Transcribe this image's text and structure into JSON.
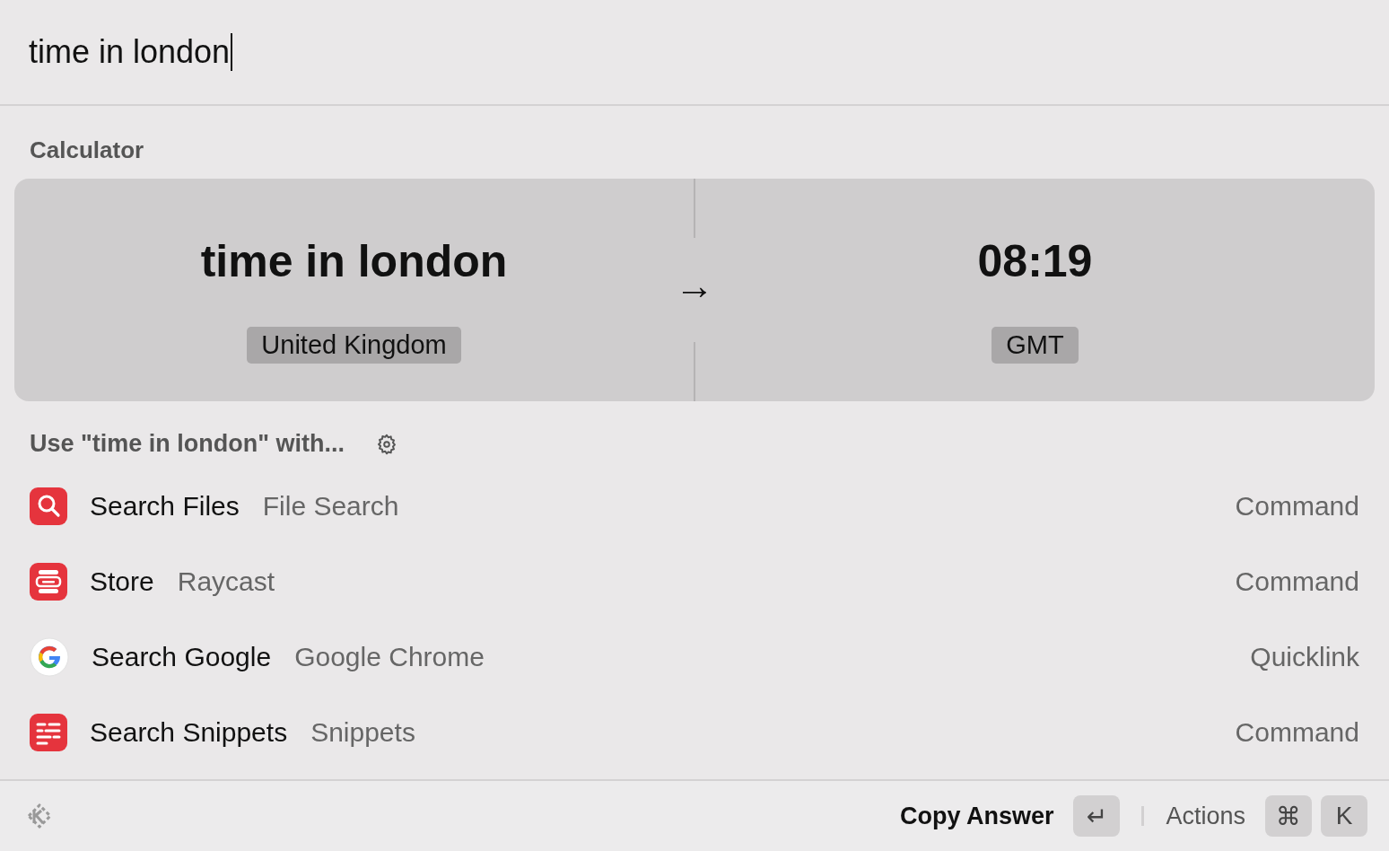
{
  "search": {
    "value": "time in london"
  },
  "calculator": {
    "section_title": "Calculator",
    "query": "time in london",
    "query_tag": "United Kingdom",
    "arrow": "→",
    "result": "08:19",
    "result_tag": "GMT"
  },
  "suggestions": {
    "title": "Use \"time in london\" with...",
    "items": [
      {
        "kind": "search",
        "title": "Search Files",
        "subtitle": "File Search",
        "type": "Command"
      },
      {
        "kind": "store",
        "title": "Store",
        "subtitle": "Raycast",
        "type": "Command"
      },
      {
        "kind": "google",
        "title": "Search Google",
        "subtitle": "Google Chrome",
        "type": "Quicklink"
      },
      {
        "kind": "snippets",
        "title": "Search Snippets",
        "subtitle": "Snippets",
        "type": "Command"
      }
    ]
  },
  "footer": {
    "primary_action": "Copy Answer",
    "primary_key": "↵",
    "actions_label": "Actions",
    "action_keys": [
      "⌘",
      "K"
    ]
  }
}
